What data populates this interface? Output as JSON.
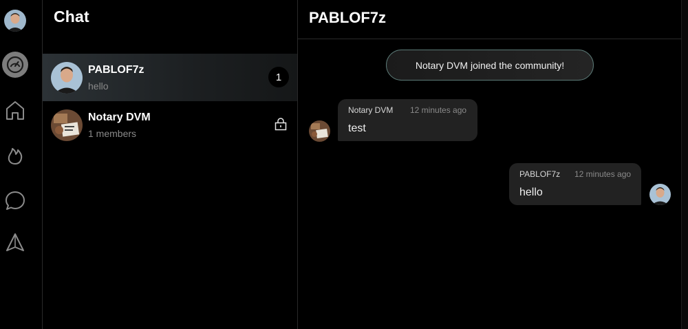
{
  "list": {
    "title": "Chat",
    "items": [
      {
        "name": "PABLOF7z",
        "subtitle": "hello",
        "unread": "1"
      },
      {
        "name": "Notary DVM",
        "subtitle": "1 members"
      }
    ]
  },
  "rail": {
    "icons": [
      "user-avatar",
      "dashboard-gauge-icon",
      "home-icon",
      "flame-icon",
      "chat-bubble-icon",
      "send-icon"
    ]
  },
  "conversation": {
    "title": "PABLOF7z",
    "system_message": "Notary DVM joined the community!",
    "messages": [
      {
        "author": "Notary DVM",
        "time": "12 minutes ago",
        "text": "test",
        "direction": "incoming"
      },
      {
        "author": "PABLOF7z",
        "time": "12 minutes ago",
        "text": "hello",
        "direction": "outgoing"
      }
    ]
  },
  "colors": {
    "background": "#000000",
    "bubble": "#222222",
    "active_row": "#2c3236",
    "accent_border": "#5c7a77",
    "muted_text": "#8a8a8a"
  }
}
